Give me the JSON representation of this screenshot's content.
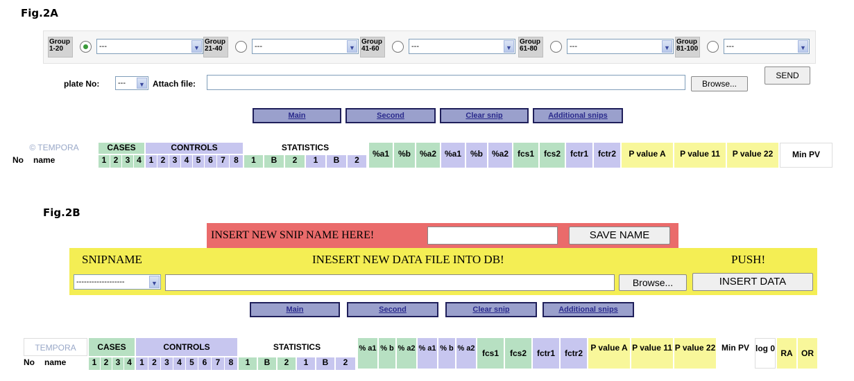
{
  "fig2a": {
    "label": "Fig.2A",
    "groups": [
      {
        "label": "Group 1-20",
        "selected": true,
        "value": "---"
      },
      {
        "label": "Group 21-40",
        "selected": false,
        "value": "---"
      },
      {
        "label": "Group 41-60",
        "selected": false,
        "value": "---"
      },
      {
        "label": "Group 61-80",
        "selected": false,
        "value": "---"
      },
      {
        "label": "Group 81-100",
        "selected": false,
        "value": "---"
      }
    ],
    "plate_label": "plate No:",
    "plate_value": "---",
    "attach_label": "Attach file:",
    "attach_value": "",
    "browse": "Browse...",
    "send": "SEND",
    "nav": [
      "Main",
      "Second",
      "Clear snip",
      "Additional snips"
    ],
    "table": {
      "tempora": "© TEMPORA",
      "no": "No",
      "name": "name",
      "cases": "CASES",
      "controls": "CONTROLS",
      "statistics": "STATISTICS",
      "case_nums": [
        "1",
        "2",
        "3",
        "4"
      ],
      "control_nums": [
        "1",
        "2",
        "3",
        "4",
        "5",
        "6",
        "7",
        "8"
      ],
      "stat_cols": [
        "1",
        "B",
        "2",
        "1",
        "B",
        "2"
      ],
      "cols": [
        "%a1",
        "%b",
        "%a2",
        "%a1",
        "%b",
        "%a2",
        "fcs1",
        "fcs2",
        "fctr1",
        "fctr2",
        "P value A",
        "P value 11",
        "P value 22",
        "Min PV"
      ]
    }
  },
  "fig2b": {
    "label": "Fig.2B",
    "insert_name": "INSERT NEW SNIP NAME HERE!",
    "insert_value": "",
    "save_name": "SAVE NAME",
    "snipname": "SNIPNAME",
    "inesert": "INESERT NEW DATA FILE INTO DB!",
    "push": "PUSH!",
    "snip_select": "-------------------",
    "file_value": "",
    "browse": "Browse...",
    "insert_data": "INSERT DATA",
    "nav": [
      "Main",
      "Second",
      "Clear snip",
      "Additional snips"
    ],
    "table": {
      "tempora": "TEMPORA",
      "no": "No",
      "name": "name",
      "cases": "CASES",
      "controls": "CONTROLS",
      "statistics": "STATISTICS",
      "case_nums": [
        "1",
        "2",
        "3",
        "4"
      ],
      "control_nums": [
        "1",
        "2",
        "3",
        "4",
        "5",
        "6",
        "7",
        "8"
      ],
      "stat_cols": [
        "1",
        "B",
        "2",
        "1",
        "B",
        "2"
      ],
      "cols": [
        "% a1",
        "% b",
        "% a2",
        "% a1",
        "% b",
        "% a2",
        "fcs1",
        "fcs2",
        "fctr1",
        "fctr2",
        "P value A",
        "P value 11",
        "P value 22",
        "Min PV",
        "log 0",
        "RA",
        "OR"
      ]
    }
  }
}
